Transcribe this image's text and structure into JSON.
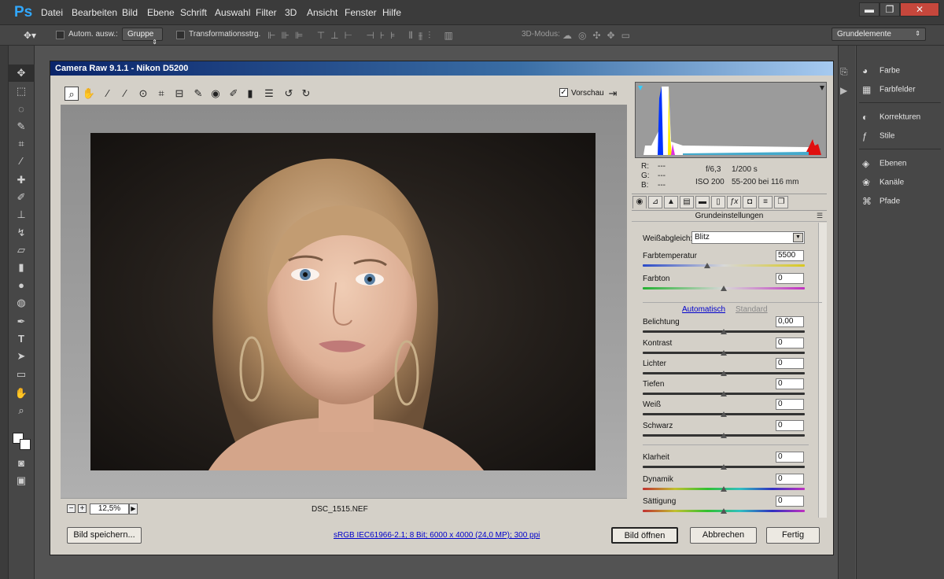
{
  "app": {
    "logo": "Ps"
  },
  "menu": [
    "Datei",
    "Bearbeiten",
    "Bild",
    "Ebene",
    "Schrift",
    "Auswahl",
    "Filter",
    "3D",
    "Ansicht",
    "Fenster",
    "Hilfe"
  ],
  "window_controls": {
    "minimize": "▬",
    "restore": "❐",
    "close": "✕"
  },
  "options": {
    "auto_select": "Autom. ausw.:",
    "group": "Gruppe",
    "transform": "Transformationsstrg.",
    "mode3d": "3D-Modus:",
    "workspace": "Grundelemente"
  },
  "right_panel": {
    "items": [
      "Farbe",
      "Farbfelder",
      "Korrekturen",
      "Stile",
      "Ebenen",
      "Kanäle",
      "Pfade"
    ]
  },
  "dialog": {
    "title": "Camera Raw 9.1.1 - Nikon D5200",
    "preview_label": "Vorschau",
    "preview_checked": true,
    "zoom": "12,5%",
    "filename": "DSC_1515.NEF",
    "info": {
      "r": "R:",
      "g": "G:",
      "b": "B:",
      "r_val": "---",
      "g_val": "---",
      "b_val": "---",
      "aperture": "f/6,3",
      "shutter": "1/200 s",
      "iso": "ISO 200",
      "lens": "55-200 bei 116 mm"
    },
    "panel_title": "Grundeinstellungen",
    "wb_label": "Weißabgleich:",
    "wb_value": "Blitz",
    "auto_link": "Automatisch",
    "default_link": "Standard",
    "sliders": [
      {
        "label": "Farbtemperatur",
        "value": "5500",
        "pos": 0.4
      },
      {
        "label": "Farbton",
        "value": "0",
        "pos": 0.5
      },
      {
        "label": "Belichtung",
        "value": "0,00",
        "pos": 0.5
      },
      {
        "label": "Kontrast",
        "value": "0",
        "pos": 0.5
      },
      {
        "label": "Lichter",
        "value": "0",
        "pos": 0.5
      },
      {
        "label": "Tiefen",
        "value": "0",
        "pos": 0.5
      },
      {
        "label": "Weiß",
        "value": "0",
        "pos": 0.5
      },
      {
        "label": "Schwarz",
        "value": "0",
        "pos": 0.5
      },
      {
        "label": "Klarheit",
        "value": "0",
        "pos": 0.5
      },
      {
        "label": "Dynamik",
        "value": "0",
        "pos": 0.5
      },
      {
        "label": "Sättigung",
        "value": "0",
        "pos": 0.5
      }
    ],
    "save_button": "Bild speichern...",
    "workflow_link": "sRGB IEC61966-2.1; 8 Bit; 6000 x 4000 (24,0 MP); 300 ppi",
    "open_button": "Bild öffnen",
    "cancel_button": "Abbrechen",
    "done_button": "Fertig"
  }
}
